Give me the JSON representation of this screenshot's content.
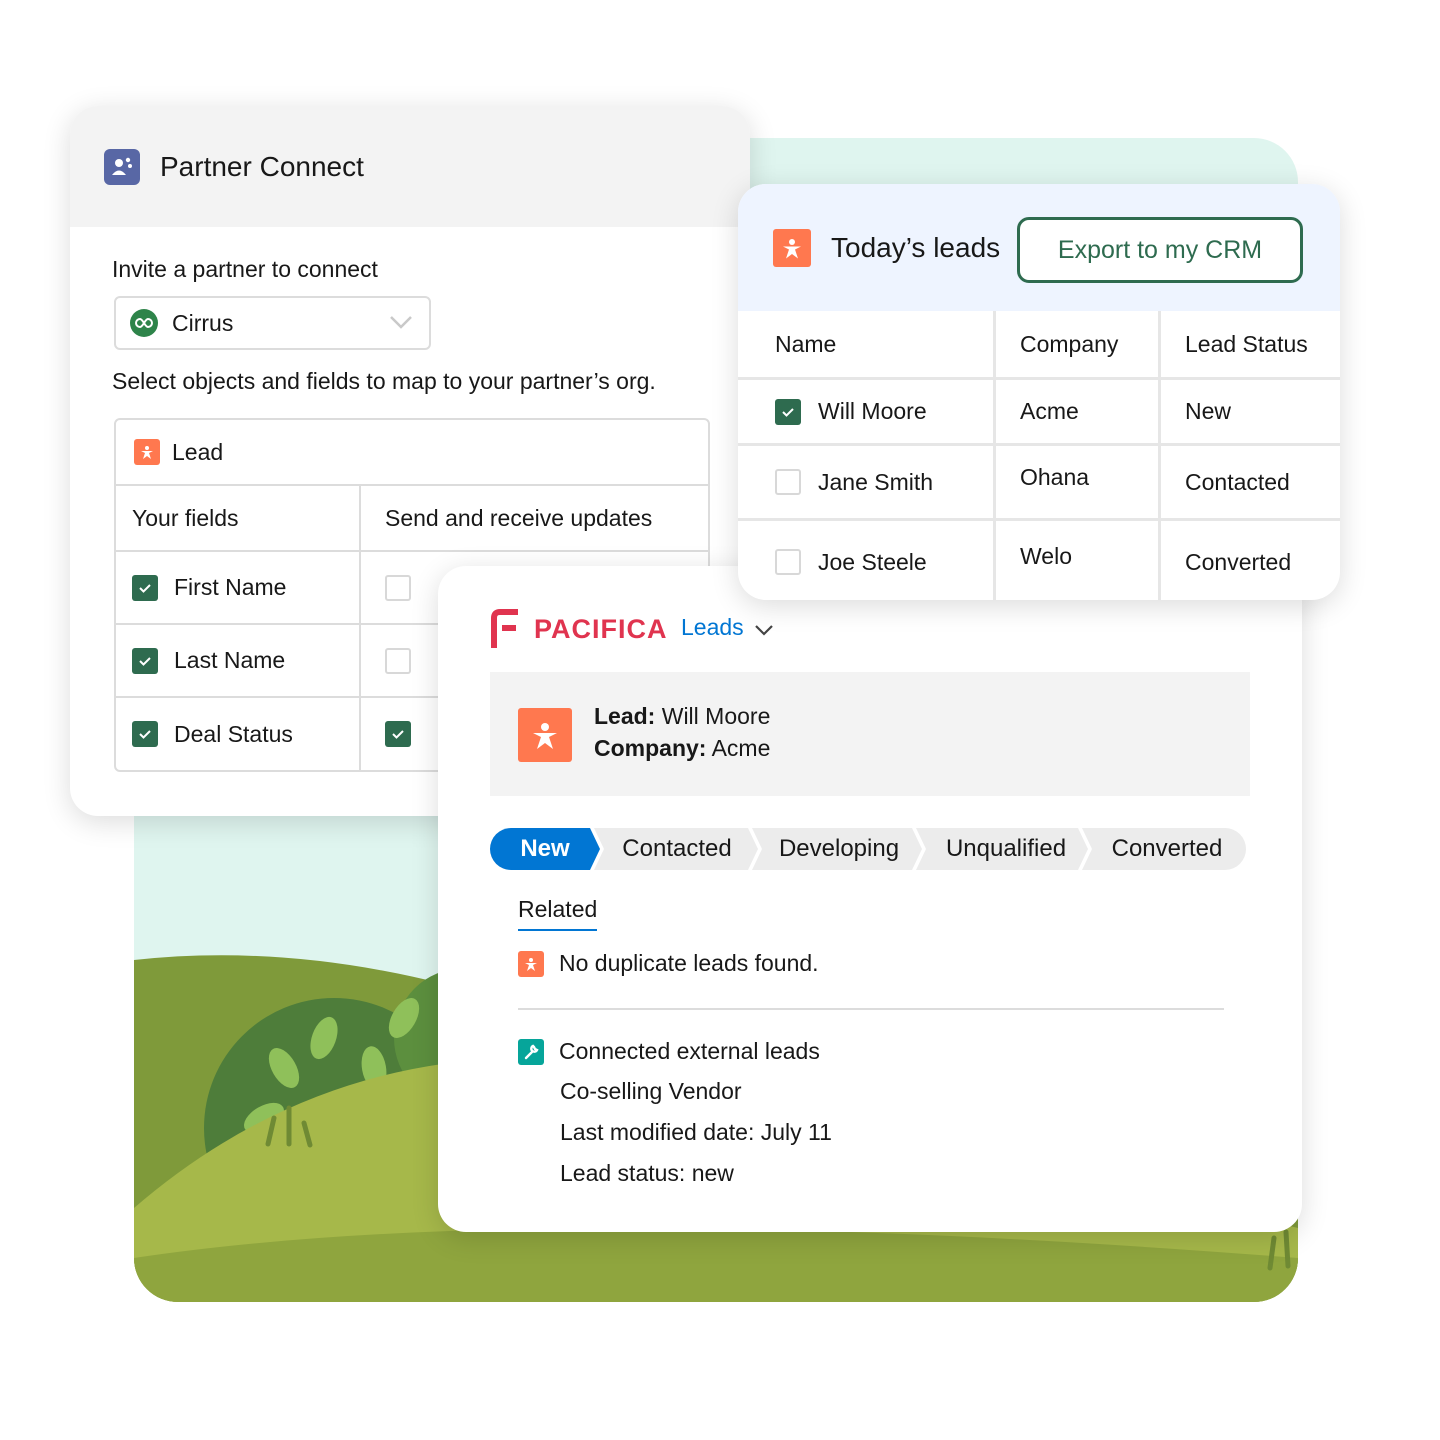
{
  "partner_connect": {
    "title": "Partner Connect",
    "invite_label": "Invite a partner to connect",
    "partner_select": {
      "value": "Cirrus"
    },
    "map_instructions": "Select objects and fields to map to your partner’s org.",
    "object": "Lead",
    "columns": [
      "Your fields",
      "Send and receive updates"
    ],
    "fields": [
      {
        "label": "First Name",
        "selected": true,
        "sync": false
      },
      {
        "label": "Last Name",
        "selected": true,
        "sync": false
      },
      {
        "label": "Deal Status",
        "selected": true,
        "sync": true
      }
    ]
  },
  "todays_leads": {
    "title": "Today’s leads",
    "export_button": "Export to my CRM",
    "columns": [
      "Name",
      "Company",
      "Lead Status"
    ],
    "rows": [
      {
        "name": "Will Moore",
        "company": "Acme",
        "status": "New",
        "checked": true
      },
      {
        "name": "Jane Smith",
        "company": "Ohana",
        "status": "Contacted",
        "checked": false
      },
      {
        "name": "Joe Steele",
        "company": "Welo",
        "status": "Converted",
        "checked": false
      }
    ]
  },
  "pacifica": {
    "brand": "PACIFICA",
    "nav": "Leads",
    "lead_label": "Lead:",
    "lead_value": "Will Moore",
    "company_label": "Company:",
    "company_value": "Acme",
    "path": [
      "New",
      "Contacted",
      "Developing",
      "Unqualified",
      "Converted"
    ],
    "path_active": "New",
    "related_tab": "Related",
    "duplicate_message": "No duplicate leads found.",
    "external": {
      "title": "Connected external leads",
      "vendor": "Co-selling Vendor",
      "modified": "Last modified date: July 11",
      "status": "Lead status: new"
    }
  },
  "colors": {
    "accent_green": "#2e6b4f",
    "brand_blue": "#0176d3",
    "lead_orange": "#ff784f",
    "pacifica_red": "#e0344f"
  },
  "icons": [
    "partner-connect-icon",
    "cirrus-logo-icon",
    "chevron-down-icon",
    "lead-icon",
    "checkbox-icon",
    "pacifica-logo-icon",
    "wrench-icon"
  ]
}
